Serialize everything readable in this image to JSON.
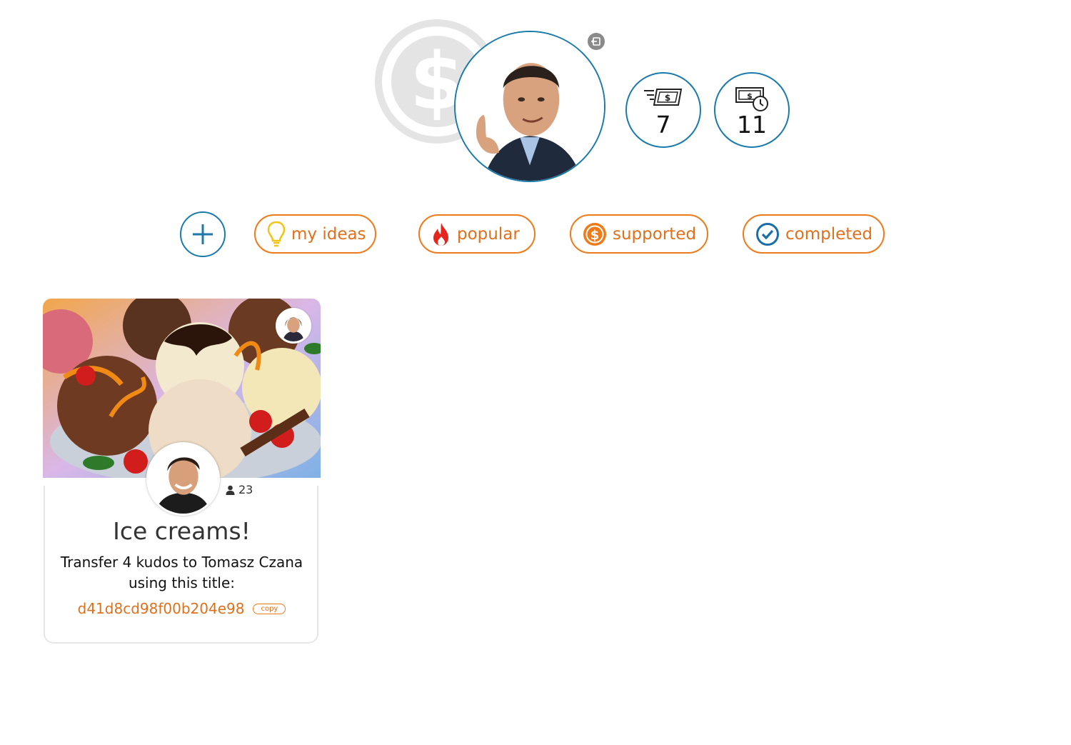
{
  "header": {
    "logout_icon": "logout-icon",
    "stats": [
      {
        "icon": "money-sent-icon",
        "value": "7"
      },
      {
        "icon": "money-pending-icon",
        "value": "11"
      }
    ]
  },
  "filters": {
    "add_icon": "plus-icon",
    "items": [
      {
        "label": "my ideas",
        "icon": "lightbulb-icon"
      },
      {
        "label": "popular",
        "icon": "fire-icon"
      },
      {
        "label": "supported",
        "icon": "dollar-coin-icon"
      },
      {
        "label": "completed",
        "icon": "check-circle-icon"
      }
    ]
  },
  "card": {
    "image": "ice-cream-photo",
    "supporters_count": "23",
    "title": "Ice creams!",
    "instruction": "Transfer 4 kudos to Tomasz Czana using this title:",
    "code": "d41d8cd98f00b204e98",
    "copy_label": "copy"
  },
  "colors": {
    "primary_blue": "#1a7aab",
    "accent_orange": "#ef7a1a",
    "text_orange": "#e0701c"
  }
}
